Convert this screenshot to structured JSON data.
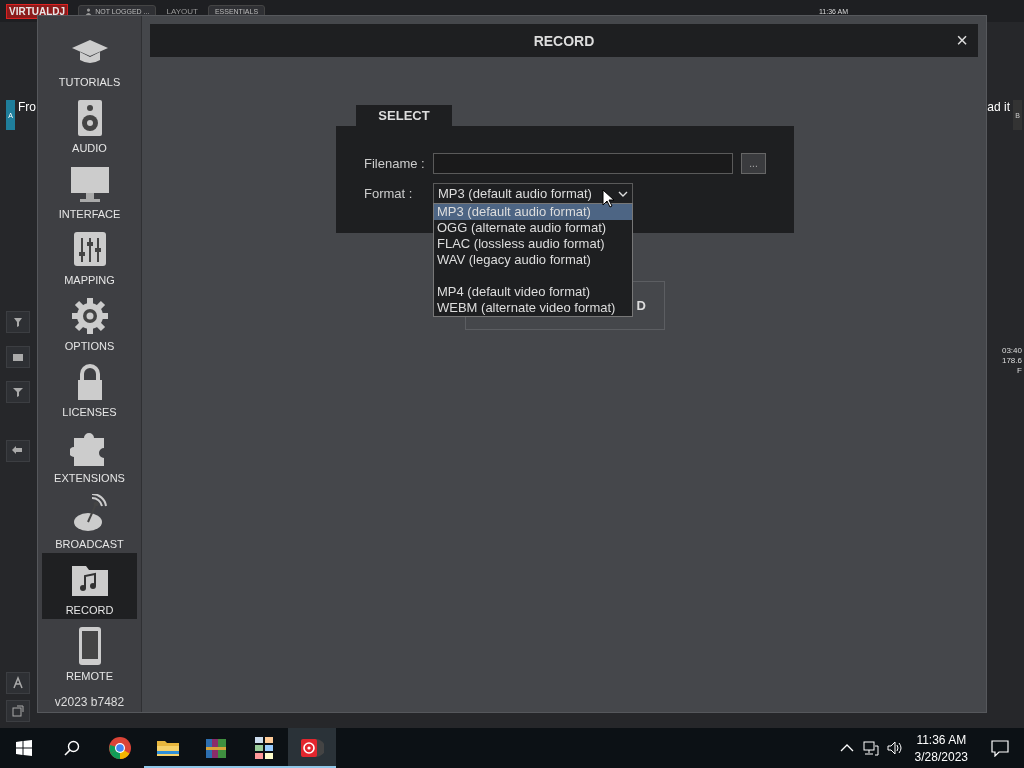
{
  "app": {
    "logo": "VIRTUALDJ",
    "login": "NOT LOGGED ...",
    "layout_label": "LAYOUT",
    "layout_value": "ESSENTIALS",
    "clock": "11:36 AM",
    "deck_a": {
      "letter": "A",
      "title": "Fro"
    },
    "deck_b": {
      "letter": "B",
      "title": "ad it"
    },
    "readings": [
      "03:40",
      "178.6",
      "F"
    ]
  },
  "dialog": {
    "sidebar": {
      "items": [
        {
          "label": "TUTORIALS",
          "selected": false
        },
        {
          "label": "AUDIO",
          "selected": false
        },
        {
          "label": "INTERFACE",
          "selected": false
        },
        {
          "label": "MAPPING",
          "selected": false
        },
        {
          "label": "OPTIONS",
          "selected": false
        },
        {
          "label": "LICENSES",
          "selected": false
        },
        {
          "label": "EXTENSIONS",
          "selected": false
        },
        {
          "label": "BROADCAST",
          "selected": false
        },
        {
          "label": "RECORD",
          "selected": true
        },
        {
          "label": "REMOTE",
          "selected": false
        }
      ],
      "version": "v2023 b7482"
    },
    "title": "RECORD",
    "close": "×",
    "tab": "SELECT",
    "filename": {
      "label": "Filename :"
    },
    "browse": "...",
    "format": {
      "label": "Format :",
      "value": "MP3 (default audio format)",
      "expanded": true,
      "options": [
        {
          "kind": "option",
          "label": "MP3 (default audio format)",
          "selected": true
        },
        {
          "kind": "option",
          "label": "OGG (alternate audio format)",
          "selected": false
        },
        {
          "kind": "option",
          "label": "FLAC (lossless audio format)",
          "selected": false
        },
        {
          "kind": "option",
          "label": "WAV (legacy audio format)",
          "selected": false
        },
        {
          "kind": "spacer"
        },
        {
          "kind": "option",
          "label": "MP4 (default video format)",
          "selected": false
        },
        {
          "kind": "option",
          "label": "WEBM (alternate video format)",
          "selected": false
        }
      ]
    },
    "record_button": "D"
  },
  "taskbar": {
    "apps": [
      {
        "kind": "chrome",
        "running": false,
        "selected": false
      },
      {
        "kind": "explorer",
        "running": true,
        "selected": false
      },
      {
        "kind": "archive",
        "running": true,
        "selected": false
      },
      {
        "kind": "tiles",
        "running": true,
        "selected": false
      },
      {
        "kind": "dj",
        "running": true,
        "selected": true
      }
    ],
    "time": "11:36 AM",
    "date": "3/28/2023"
  }
}
